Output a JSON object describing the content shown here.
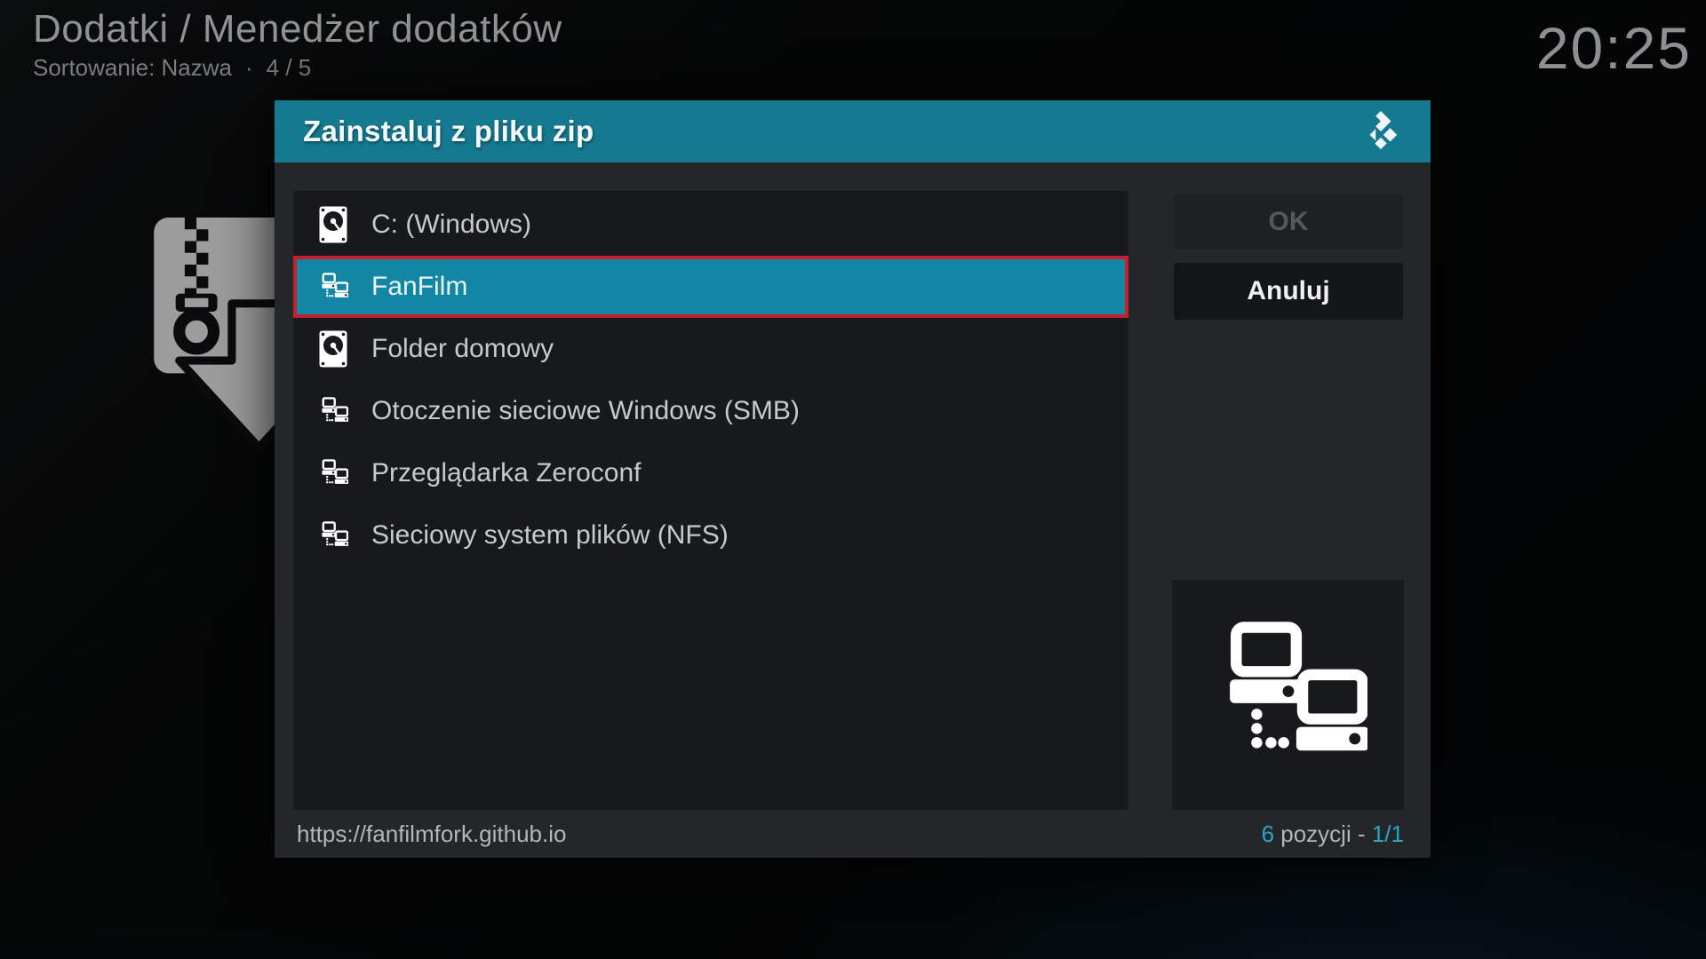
{
  "colors": {
    "titlebar_teal": "#15798f",
    "selected_row_teal": "#1286a3",
    "selection_border_red": "#c41f2a",
    "accent_teal_text": "#2ba4c7"
  },
  "header": {
    "breadcrumb": "Dodatki / Menedżer dodatków",
    "sort_label": "Sortowanie: Nazwa",
    "separator": "·",
    "position": "4 / 5",
    "clock": "20:25"
  },
  "dialog": {
    "title": "Zainstaluj z pliku zip",
    "items": [
      {
        "label": "C: (Windows)",
        "icon": "hdd-icon",
        "selected": false
      },
      {
        "label": "FanFilm",
        "icon": "network-icon",
        "selected": true
      },
      {
        "label": "Folder domowy",
        "icon": "hdd-icon",
        "selected": false
      },
      {
        "label": "Otoczenie sieciowe Windows (SMB)",
        "icon": "network-icon",
        "selected": false
      },
      {
        "label": "Przeglądarka Zeroconf",
        "icon": "network-icon",
        "selected": false
      },
      {
        "label": "Sieciowy system plików (NFS)",
        "icon": "network-icon",
        "selected": false
      }
    ],
    "buttons": {
      "ok": "OK",
      "cancel": "Anuluj"
    },
    "footer": {
      "path": "https://fanfilmfork.github.io",
      "count": "6",
      "count_label": " pozycji - ",
      "page": "1/1"
    }
  }
}
